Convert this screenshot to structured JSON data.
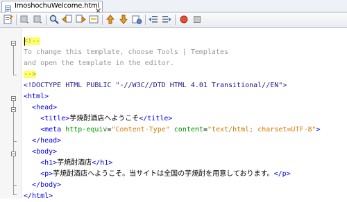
{
  "tab": {
    "title": "ImoshochuWelcome.html"
  },
  "editor": {
    "lines": [
      {
        "parts": [
          {
            "text": "<!--",
            "kind": "com",
            "hl": true
          }
        ]
      },
      {
        "parts": [
          {
            "text": "To change this template, choose Tools | Templates",
            "kind": "com"
          }
        ]
      },
      {
        "parts": [
          {
            "text": "and open the template in the editor.",
            "kind": "com"
          }
        ]
      },
      {
        "parts": [
          {
            "text": "-->",
            "kind": "com",
            "hl": true
          }
        ]
      },
      {
        "parts": [
          {
            "text": "<!DOCTYPE HTML PUBLIC \"-//W3C//DTD HTML 4.01 Transitional//EN\">",
            "kind": "doc"
          }
        ]
      },
      {
        "parts": [
          {
            "text": "<html>",
            "kind": "tag"
          }
        ]
      },
      {
        "parts": [
          {
            "text": "  ",
            "kind": "text"
          },
          {
            "text": "<head>",
            "kind": "tag"
          }
        ]
      },
      {
        "parts": [
          {
            "text": "    ",
            "kind": "text"
          },
          {
            "text": "<title>",
            "kind": "tag"
          },
          {
            "text": "芋焼酎酒店へようこそ",
            "kind": "text"
          },
          {
            "text": "</title>",
            "kind": "tag"
          }
        ]
      },
      {
        "parts": [
          {
            "text": "    ",
            "kind": "text"
          },
          {
            "text": "<meta ",
            "kind": "tag"
          },
          {
            "text": "http-equiv",
            "kind": "attr"
          },
          {
            "text": "=",
            "kind": "text"
          },
          {
            "text": "\"Content-Type\"",
            "kind": "val"
          },
          {
            "text": " content",
            "kind": "attr"
          },
          {
            "text": "=",
            "kind": "text"
          },
          {
            "text": "\"text/html; charset=UTF-8\"",
            "kind": "val"
          },
          {
            "text": ">",
            "kind": "tag"
          }
        ]
      },
      {
        "parts": [
          {
            "text": "  ",
            "kind": "text"
          },
          {
            "text": "</head>",
            "kind": "tag"
          }
        ]
      },
      {
        "parts": [
          {
            "text": "  ",
            "kind": "text"
          },
          {
            "text": "<body>",
            "kind": "tag"
          }
        ]
      },
      {
        "parts": [
          {
            "text": "    ",
            "kind": "text"
          },
          {
            "text": "<h1>",
            "kind": "tag"
          },
          {
            "text": "芋焼酎酒店",
            "kind": "text"
          },
          {
            "text": "</h1>",
            "kind": "tag"
          }
        ]
      },
      {
        "parts": [
          {
            "text": "    ",
            "kind": "text"
          },
          {
            "text": "<p>",
            "kind": "tag"
          },
          {
            "text": "芋焼酎酒店へようこそ。当サイトは全国の芋焼酎を用意しております。",
            "kind": "text"
          },
          {
            "text": "</p>",
            "kind": "tag"
          }
        ]
      },
      {
        "parts": [
          {
            "text": "  ",
            "kind": "text"
          },
          {
            "text": "</body>",
            "kind": "tag"
          }
        ]
      },
      {
        "parts": [
          {
            "text": "</html>",
            "kind": "tag"
          }
        ]
      }
    ]
  },
  "toolbar": {
    "buttons": [
      "last-edit-icon",
      "back-icon",
      "forward-icon",
      "find-icon",
      "find-previous-icon",
      "find-next-icon",
      "toggle-highlight-icon",
      "previous-bookmark-icon",
      "next-bookmark-icon",
      "toggle-bookmark-icon",
      "shift-left-icon",
      "shift-right-icon",
      "start-macro-icon",
      "stop-macro-icon"
    ]
  }
}
